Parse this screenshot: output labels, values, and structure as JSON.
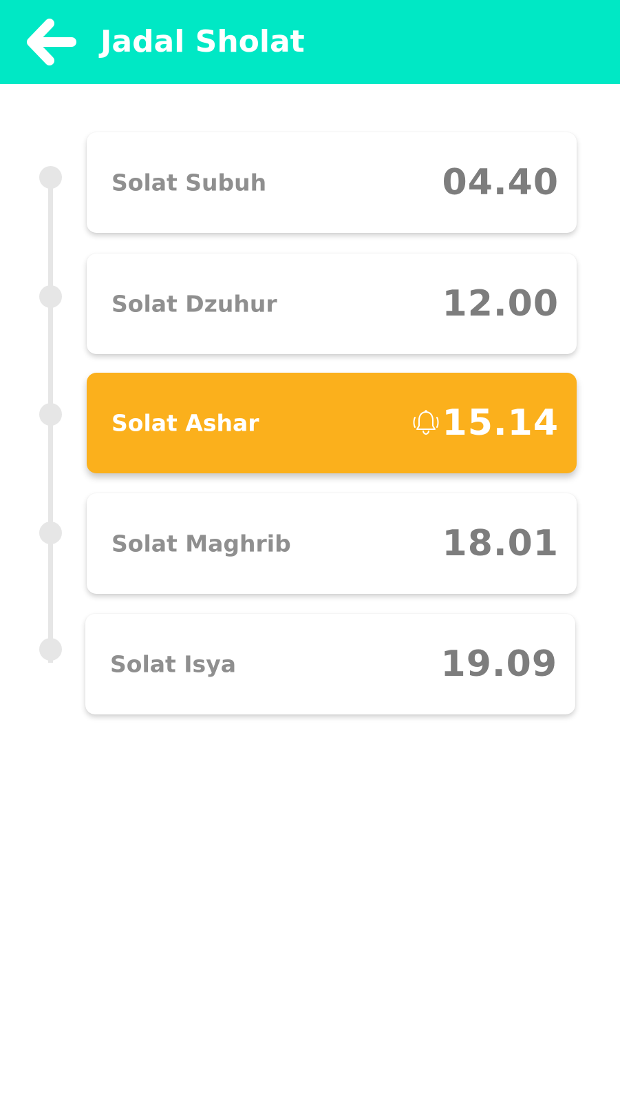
{
  "header": {
    "title": "Jadal Sholat",
    "back_icon": "arrow-left-icon",
    "background_color": "#00E8C5"
  },
  "schedule": [
    {
      "name": "Solat Subuh",
      "time": "04.40",
      "active": false
    },
    {
      "name": "Solat Dzuhur",
      "time": "12.00",
      "active": false
    },
    {
      "name": "Solat Ashar",
      "time": "15.14",
      "active": true,
      "icon": "bell-ringing-icon"
    },
    {
      "name": "Solat Maghrib",
      "time": "18.01",
      "active": false
    },
    {
      "name": "Solat Isya",
      "time": "19.09",
      "active": false
    }
  ],
  "colors": {
    "active_card": "#FBB01C",
    "timeline": "#E6E6E6",
    "text_gray": "#8F8F8F"
  }
}
